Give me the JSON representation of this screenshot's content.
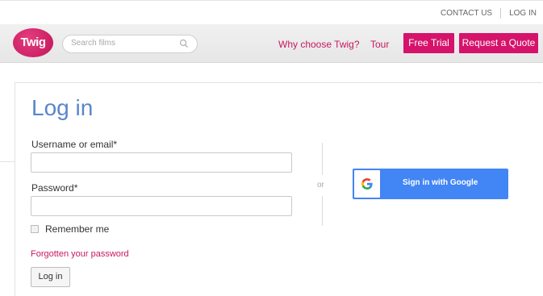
{
  "topbar": {
    "contact_label": "CONTACT US",
    "login_label": "LOG IN"
  },
  "navbar": {
    "logo_text": "Twig",
    "search_placeholder": "Search films",
    "why_label": "Why choose Twig?",
    "tour_label": "Tour",
    "trial_label": "Free Trial",
    "quote_label": "Request a Quote"
  },
  "login": {
    "title": "Log in",
    "username_label": "Username or email*",
    "username_value": "",
    "password_label": "Password*",
    "password_value": "",
    "remember_label": "Remember me",
    "forgot_label": "Forgotten your password",
    "submit_label": "Log in",
    "or_label": "or",
    "google_label": "Sign in with Google"
  },
  "colors": {
    "brand_pink": "#d6136a",
    "title_blue": "#5a86c7",
    "google_blue": "#4285f4"
  },
  "icons": {
    "search": "search-icon",
    "google": "google-logo-icon"
  }
}
